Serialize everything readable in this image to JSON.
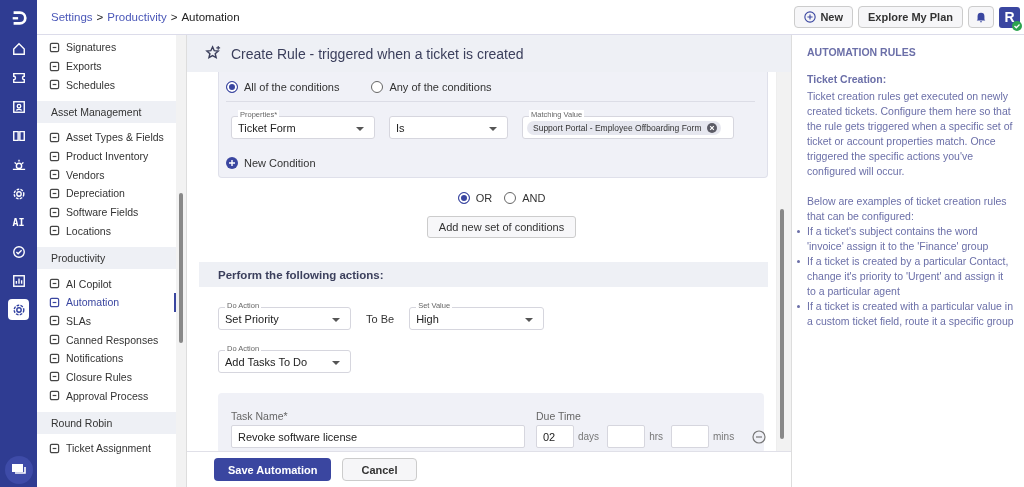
{
  "rail": {
    "items": [
      {
        "selected": false
      },
      {
        "selected": false
      },
      {
        "selected": false
      },
      {
        "selected": false
      },
      {
        "selected": false
      },
      {
        "selected": false
      },
      {
        "label": "AI",
        "selected": false
      },
      {
        "selected": false
      },
      {
        "selected": false
      },
      {
        "selected": true
      }
    ]
  },
  "breadcrumb": [
    {
      "label": "Settings",
      "link": true
    },
    {
      "label": ">",
      "link": false
    },
    {
      "label": "Productivity",
      "link": true
    },
    {
      "label": ">",
      "link": false
    },
    {
      "label": "Automation",
      "link": false
    }
  ],
  "top_actions": {
    "new_button": "New",
    "plan_button": "Explore My Plan",
    "avatar": "R"
  },
  "sidebar": {
    "sections": [
      {
        "items": [
          {
            "label": "Signatures",
            "selected": false
          },
          {
            "label": "Exports",
            "selected": false
          },
          {
            "label": "Schedules",
            "selected": false
          }
        ]
      },
      {
        "title": "Asset Management",
        "items": [
          {
            "label": "Asset Types & Fields",
            "selected": false
          },
          {
            "label": "Product Inventory",
            "selected": false
          },
          {
            "label": "Vendors",
            "selected": false
          },
          {
            "label": "Depreciation",
            "selected": false
          },
          {
            "label": "Software Fields",
            "selected": false
          },
          {
            "label": "Locations",
            "selected": false
          }
        ]
      },
      {
        "title": "Productivity",
        "items": [
          {
            "label": "AI Copilot",
            "selected": false
          },
          {
            "label": "Automation",
            "selected": true
          },
          {
            "label": "SLAs",
            "selected": false
          },
          {
            "label": "Canned Responses",
            "selected": false
          },
          {
            "label": "Notifications",
            "selected": false
          },
          {
            "label": "Closure Rules",
            "selected": false
          },
          {
            "label": "Approval Process",
            "selected": false
          }
        ]
      },
      {
        "title": "Round Robin",
        "items": [
          {
            "label": "Ticket Assignment",
            "selected": false
          }
        ]
      }
    ]
  },
  "page_title": "Create Rule - triggered when a ticket is created",
  "conditions": {
    "match_options": [
      {
        "label": "All of the conditions",
        "selected": true
      },
      {
        "label": "Any of the conditions",
        "selected": false
      }
    ],
    "rows": [
      {
        "property_label": "Properties*",
        "property": "Ticket Form",
        "operator": "Is",
        "value_label": "Matching Value",
        "values": [
          "Support Portal - Employee Offboarding Form"
        ]
      }
    ],
    "new_condition": "New Condition"
  },
  "join_options": [
    {
      "label": "OR",
      "selected": true
    },
    {
      "label": "AND",
      "selected": false
    }
  ],
  "add_set_button": "Add new set of conditions",
  "actions": {
    "title": "Perform the following actions:",
    "rows": [
      {
        "action_label": "Do Action",
        "action": "Set Priority",
        "joiner": "To Be",
        "value_label": "Set Value",
        "value": "High"
      },
      {
        "action_label": "Do Action",
        "action": "Add Tasks To Do"
      }
    ],
    "task": {
      "name_label": "Task Name*",
      "name": "Revoke software license",
      "due_label": "Due Time",
      "days": "02",
      "days_unit": "days",
      "hrs_unit": "hrs",
      "mins_unit": "mins"
    }
  },
  "footer": {
    "save": "Save Automation",
    "cancel": "Cancel"
  },
  "help": {
    "title": "AUTOMATION RULES",
    "subtitle": "Ticket Creation:",
    "paragraphs": [
      "Ticket creation rules get executed on newly created tickets. Configure them here so that the rule gets triggered when a specific set of ticket or account properties match. Once triggered the specific actions you've configured will occur.",
      "Below are examples of ticket creation rules that can be configured:"
    ],
    "examples": [
      "If a ticket's subject contains the word 'invoice' assign it to the 'Finance' group",
      "If a ticket is created by a particular Contact, change it's priority to 'Urgent' and assign it to a particular agent",
      "If a ticket is created with a particular value in a custom ticket field, route it a specific group"
    ]
  }
}
